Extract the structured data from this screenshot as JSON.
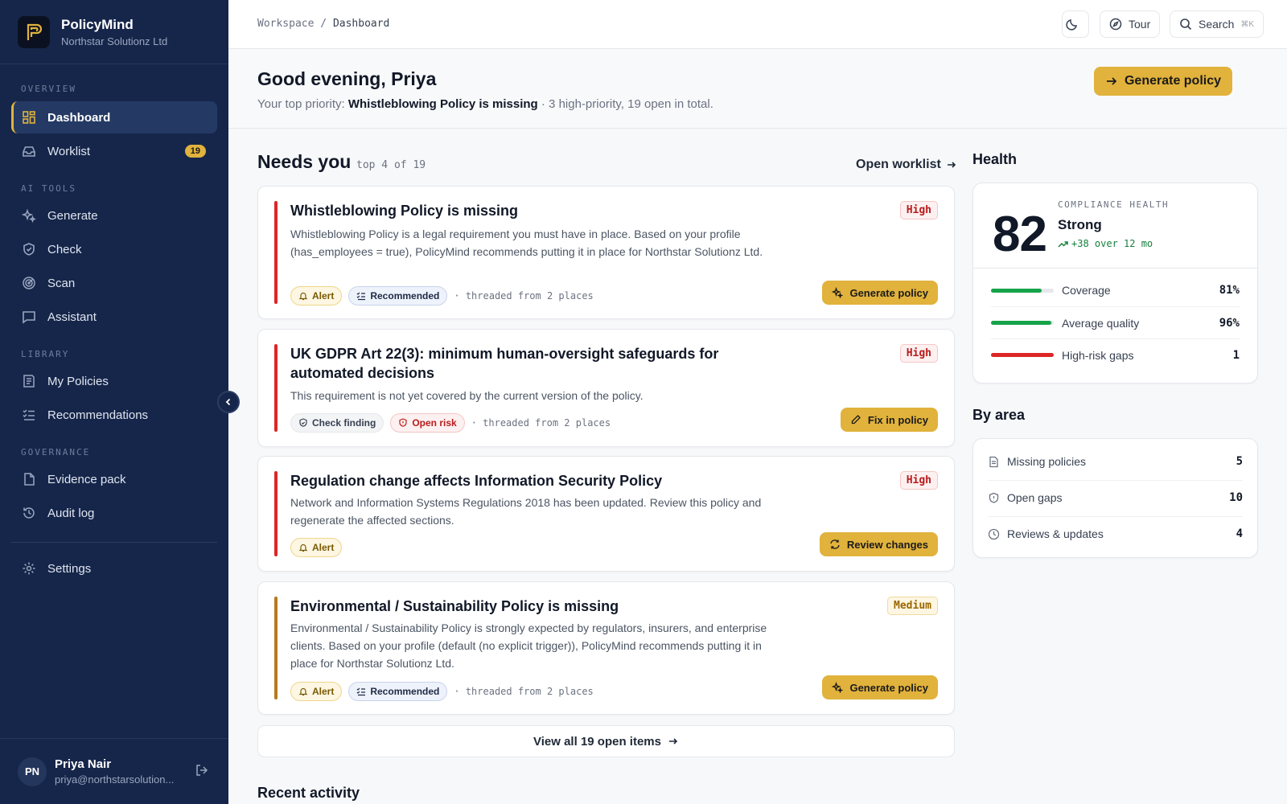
{
  "app": {
    "name": "PolicyMind",
    "org": "Northstar Solutionz Ltd"
  },
  "sidebar": {
    "sections": {
      "overview": "OVERVIEW",
      "ai_tools": "AI TOOLS",
      "library": "LIBRARY",
      "governance": "GOVERNANCE"
    },
    "items": {
      "dashboard": "Dashboard",
      "worklist": "Worklist",
      "worklist_count": "19",
      "generate": "Generate",
      "check": "Check",
      "scan": "Scan",
      "assistant": "Assistant",
      "my_policies": "My Policies",
      "recommendations": "Recommendations",
      "evidence_pack": "Evidence pack",
      "audit_log": "Audit log",
      "settings": "Settings"
    },
    "user": {
      "initials": "PN",
      "name": "Priya Nair",
      "email": "priya@northstarsolution..."
    }
  },
  "topbar": {
    "breadcrumb_root": "Workspace",
    "breadcrumb_sep": "/",
    "breadcrumb_current": "Dashboard",
    "tour": "Tour",
    "search": "Search",
    "search_shortcut": "⌘K"
  },
  "hero": {
    "greeting": "Good evening, Priya",
    "priority_prefix": "Your top priority:",
    "priority_item": "Whistleblowing Policy is missing",
    "priority_suffix": "· 3 high-priority, 19 open in total.",
    "cta": "Generate policy"
  },
  "needs_you": {
    "title": "Needs you",
    "subtitle": "top 4 of 19",
    "open_worklist": "Open worklist",
    "cards": [
      {
        "title": "Whistleblowing Policy is missing",
        "priority": "High",
        "description": "Whistleblowing Policy is a legal requirement you must have in place. Based on your profile (has_employees = true), PolicyMind recommends putting it in place for Northstar Solutionz Ltd.",
        "tags": [
          "Alert",
          "Recommended"
        ],
        "threaded": "· threaded from 2 places",
        "action": "Generate policy"
      },
      {
        "title": "UK GDPR Art 22(3): minimum human-oversight safeguards for automated decisions",
        "priority": "High",
        "description": "This requirement is not yet covered by the current version of the policy.",
        "tags": [
          "Check finding",
          "Open risk"
        ],
        "threaded": "· threaded from 2 places",
        "action": "Fix in policy"
      },
      {
        "title": "Regulation change affects Information Security Policy",
        "priority": "High",
        "description": "Network and Information Systems Regulations 2018 has been updated. Review this policy and regenerate the affected sections.",
        "tags": [
          "Alert"
        ],
        "action": "Review changes"
      },
      {
        "title": "Environmental / Sustainability Policy is missing",
        "priority": "Medium",
        "description": "Environmental / Sustainability Policy is strongly expected by regulators, insurers, and enterprise clients. Based on your profile (default (no explicit trigger)), PolicyMind recommends putting it in place for Northstar Solutionz Ltd.",
        "tags": [
          "Alert",
          "Recommended"
        ],
        "threaded": "· threaded from 2 places",
        "action": "Generate policy"
      }
    ],
    "view_all": "View all 19 open items"
  },
  "recent_activity": {
    "title": "Recent activity"
  },
  "health": {
    "title": "Health",
    "label": "COMPLIANCE HEALTH",
    "score": "82",
    "status": "Strong",
    "trend": "+38 over 12 mo",
    "metrics": [
      {
        "label": "Coverage",
        "value": "81%",
        "fill": 0.81,
        "color": "#16a34a"
      },
      {
        "label": "Average quality",
        "value": "96%",
        "fill": 0.96,
        "color": "#16a34a"
      },
      {
        "label": "High-risk gaps",
        "value": "1",
        "fill": 1.0,
        "color": "#dc2626"
      }
    ]
  },
  "by_area": {
    "title": "By area",
    "rows": [
      {
        "label": "Missing policies",
        "value": "5"
      },
      {
        "label": "Open gaps",
        "value": "10"
      },
      {
        "label": "Reviews & updates",
        "value": "4"
      }
    ]
  },
  "colors": {
    "accent": "#e1b23c",
    "sidebar": "#16264a",
    "high": "#dc2626",
    "medium": "#b7791f"
  }
}
